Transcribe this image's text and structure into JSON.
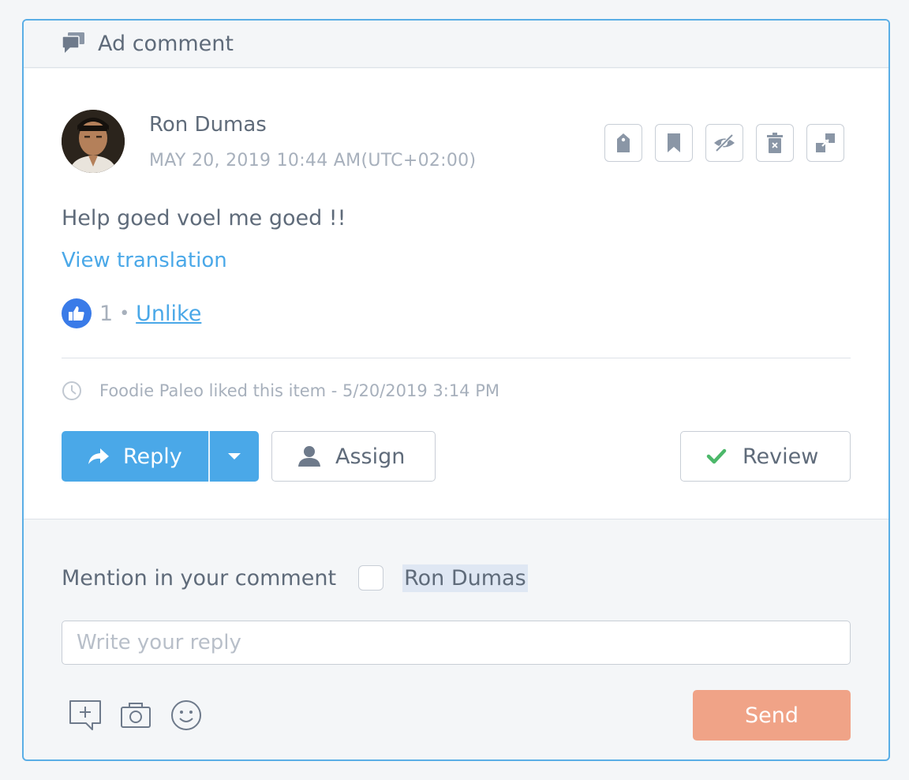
{
  "header": {
    "title": "Ad comment",
    "icon": "comments-icon"
  },
  "comment": {
    "author": "Ron Dumas",
    "timestamp": "MAY 20, 2019 10:44 AM(UTC+02:00)",
    "text": "Help goed voel me goed !!",
    "translate_label": "View translation",
    "likes": {
      "count": "1",
      "separator": "•",
      "action_label": "Unlike"
    },
    "actions": [
      "tag-icon",
      "bookmark-icon",
      "hide-icon",
      "delete-icon",
      "open-external-icon"
    ]
  },
  "activity": {
    "text": "Foodie Paleo liked this item - 5/20/2019 3:14 PM",
    "icon": "clock-icon"
  },
  "buttons": {
    "reply": "Reply",
    "assign": "Assign",
    "review": "Review"
  },
  "composer": {
    "mention_label": "Mention in your comment",
    "mention_name": "Ron Dumas",
    "placeholder": "Write your reply",
    "send": "Send",
    "tools": [
      "add-note-icon",
      "camera-icon",
      "emoji-icon"
    ]
  },
  "colors": {
    "accent": "#4aa8e8",
    "send": "#f0a387",
    "check": "#4cb86a",
    "border": "#5aaee6"
  }
}
